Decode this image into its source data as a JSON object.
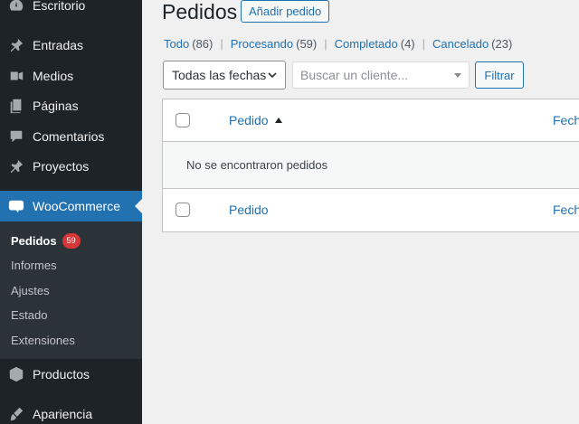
{
  "sidebar": {
    "items": [
      {
        "label": "Escritorio",
        "icon": "dashboard-icon"
      },
      {
        "label": "Entradas",
        "icon": "pin-icon"
      },
      {
        "label": "Medios",
        "icon": "media-icon"
      },
      {
        "label": "Páginas",
        "icon": "pages-icon"
      },
      {
        "label": "Comentarios",
        "icon": "comments-icon"
      },
      {
        "label": "Proyectos",
        "icon": "pin-icon"
      },
      {
        "label": "WooCommerce",
        "icon": "woocommerce-icon"
      },
      {
        "label": "Productos",
        "icon": "box-icon"
      },
      {
        "label": "Apariencia",
        "icon": "brush-icon"
      }
    ],
    "woo_logo_text": "woo",
    "submenu": [
      {
        "label": "Pedidos",
        "badge": "59"
      },
      {
        "label": "Informes"
      },
      {
        "label": "Ajustes"
      },
      {
        "label": "Estado"
      },
      {
        "label": "Extensiones"
      }
    ]
  },
  "header": {
    "title": "Pedidos",
    "add_button": "Añadir pedido"
  },
  "filters": {
    "views": [
      {
        "label": "Todo",
        "count": "(86)"
      },
      {
        "label": "Procesando",
        "count": "(59)"
      },
      {
        "label": "Completado",
        "count": "(4)"
      },
      {
        "label": "Cancelado",
        "count": "(23)"
      }
    ],
    "separator": "|",
    "date_select": "Todas las fechas",
    "customer_placeholder": "Buscar un cliente...",
    "filter_button": "Filtrar"
  },
  "table": {
    "col_order": "Pedido",
    "col_date": "Fecha",
    "empty_message": "No se encontraron pedidos"
  },
  "colors": {
    "sidebar_bg": "#1d2327",
    "accent": "#2271b1",
    "badge": "#d63638"
  }
}
